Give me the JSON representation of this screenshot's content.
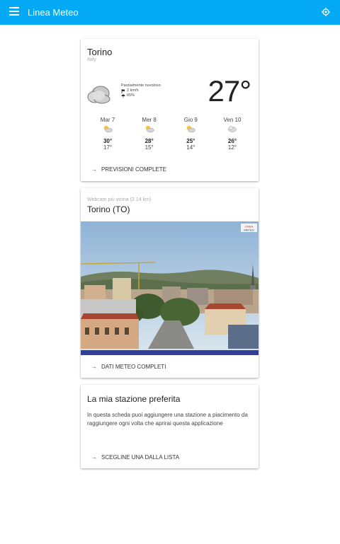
{
  "appbar": {
    "title": "Linea Meteo",
    "menu_icon": "menu-icon",
    "location_icon": "gps-icon",
    "color": "#03a9f4"
  },
  "weather": {
    "city": "Torino",
    "country": "Italy",
    "condition": "Parzialmente nuvoloso",
    "wind": "2 km/h",
    "humidity": "65%",
    "temperature": "27°",
    "forecast": [
      {
        "day": "Mar 7",
        "max": "30°",
        "min": "17°",
        "icon": "partly-cloudy-icon"
      },
      {
        "day": "Mer 8",
        "max": "28°",
        "min": "15°",
        "icon": "partly-cloudy-icon"
      },
      {
        "day": "Gio 9",
        "max": "25°",
        "min": "14°",
        "icon": "partly-cloudy-icon"
      },
      {
        "day": "Ven 10",
        "max": "26°",
        "min": "12°",
        "icon": "cloudy-icon"
      }
    ],
    "full_forecast_label": "PREVISIONI COMPLETE"
  },
  "webcam": {
    "subtitle": "Webcam più vicina (2.14 km)",
    "title": "Torino (TO)",
    "logo_line1": "LINEA",
    "logo_line2": "METEO",
    "full_data_label": "DATI METEO COMPLETI"
  },
  "favorite": {
    "title": "La mia stazione preferita",
    "text": "In questa scheda puoi aggiungere una stazione a piacimento da raggiungere ogni volta che aprirai questa applicazione",
    "choose_label": "SCEGLINE UNA DALLA LISTA"
  }
}
